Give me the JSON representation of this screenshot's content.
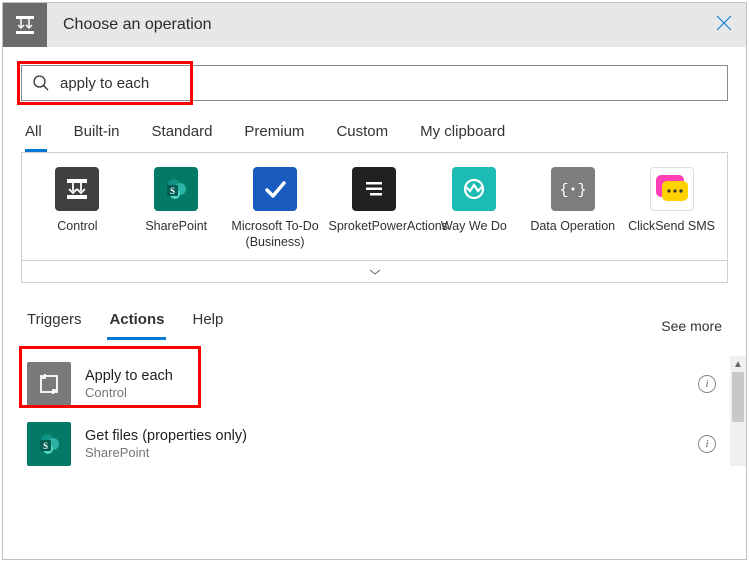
{
  "header": {
    "title": "Choose an operation"
  },
  "search": {
    "value": "apply to each"
  },
  "filterTabs": [
    "All",
    "Built-in",
    "Standard",
    "Premium",
    "Custom",
    "My clipboard"
  ],
  "filterActive": 0,
  "connectors": [
    {
      "label": "Control",
      "icon": "control"
    },
    {
      "label": "SharePoint",
      "icon": "sharepoint"
    },
    {
      "label": "Microsoft To-Do (Business)",
      "icon": "todo"
    },
    {
      "label": "SproketPowerActions",
      "icon": "sproket"
    },
    {
      "label": "Way We Do",
      "icon": "wwd"
    },
    {
      "label": "Data Operation",
      "icon": "data"
    },
    {
      "label": "ClickSend SMS",
      "icon": "clicksend"
    }
  ],
  "sectionTabs": [
    "Triggers",
    "Actions",
    "Help"
  ],
  "sectionActive": 1,
  "seeMore": "See more",
  "actions": [
    {
      "title": "Apply to each",
      "sub": "Control",
      "icon": "apply"
    },
    {
      "title": "Get files (properties only)",
      "sub": "SharePoint",
      "icon": "sharepoint"
    }
  ]
}
